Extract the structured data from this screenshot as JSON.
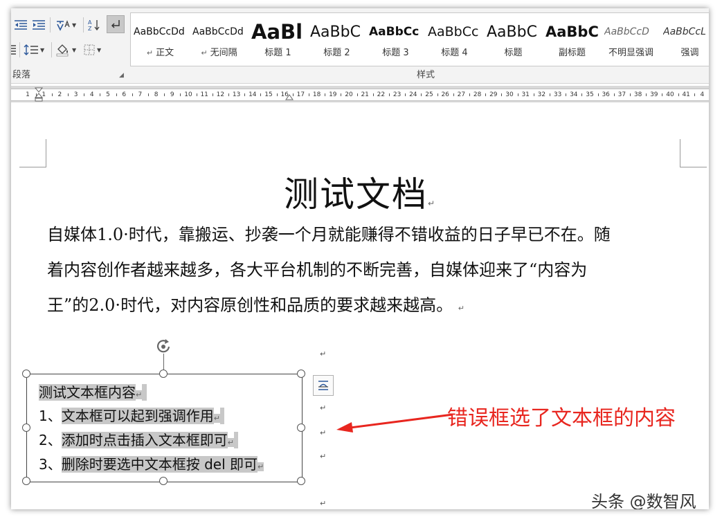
{
  "ribbon": {
    "paragraph_group": {
      "label": "段落",
      "buttons": {
        "decrease_indent": "decrease-indent-icon",
        "increase_indent": "increase-indent-icon",
        "chinese_layout": "chinese-layout-icon",
        "sort": "sort-icon",
        "show_marks": "paragraph-mark-icon",
        "line_spacing": "line-spacing-icon",
        "shading": "shading-icon",
        "borders": "borders-icon"
      }
    },
    "styles_group": {
      "label": "样式",
      "styles": [
        {
          "preview": "AaBbCcDd",
          "name": "正文",
          "mark": "↵"
        },
        {
          "preview": "AaBbCcDd",
          "name": "无间隔",
          "mark": "↵"
        },
        {
          "preview": "AaBl",
          "name": "标题 1"
        },
        {
          "preview": "AaBbC",
          "name": "标题 2"
        },
        {
          "preview": "AaBbCc",
          "name": "标题 3"
        },
        {
          "preview": "AaBbCc",
          "name": "标题 4"
        },
        {
          "preview": "AaBbC",
          "name": "标题"
        },
        {
          "preview": "AaBbC",
          "name": "副标题"
        },
        {
          "preview": "AaBbCcD",
          "name": "不明显强调"
        },
        {
          "preview": "AaBbCcL",
          "name": "强调"
        }
      ]
    }
  },
  "ruler": {
    "labels": [
      "1",
      "1",
      "2",
      "3",
      "4",
      "5",
      "6",
      "7",
      "8",
      "9",
      "10",
      "11",
      "12",
      "13",
      "14",
      "15",
      "16",
      "17",
      "18",
      "19",
      "20",
      "21",
      "22",
      "23",
      "24",
      "25",
      "26",
      "27",
      "28",
      "29",
      "30",
      "31",
      "32",
      "33",
      "34",
      "35",
      "36",
      "37",
      "38",
      "39",
      "40",
      "41",
      "4"
    ]
  },
  "document": {
    "title": "测试文档",
    "paragraph_lines": [
      "自媒体1.0·时代，靠搬运、抄袭一个月就能赚得不错收益的日子早已不在。随",
      "着内容创作者越来越多，各大平台机制的不断完善，自媒体迎来了“内容为",
      "王”的2.0·时代，对内容原创性和品质的要求越来越高。"
    ],
    "paragraph_mark": "↵",
    "textbox": {
      "lines": [
        {
          "prefix": "",
          "text": "测试文本框内容"
        },
        {
          "prefix": "1、",
          "text": "文本框可以起到强调作用"
        },
        {
          "prefix": "2、",
          "text": "添加时点击插入文本框即可"
        },
        {
          "prefix": "3、",
          "text": "删除时要选中文本框按 del 即可"
        }
      ]
    }
  },
  "annotation": {
    "text": "错误框选了文本框的内容",
    "color": "#e8261f"
  },
  "watermark": "头条 @数智风",
  "colors": {
    "ribbon_bg": "#f3f3f3",
    "selection_highlight": "#c8c8c8",
    "icon_blue": "#2b579a"
  }
}
